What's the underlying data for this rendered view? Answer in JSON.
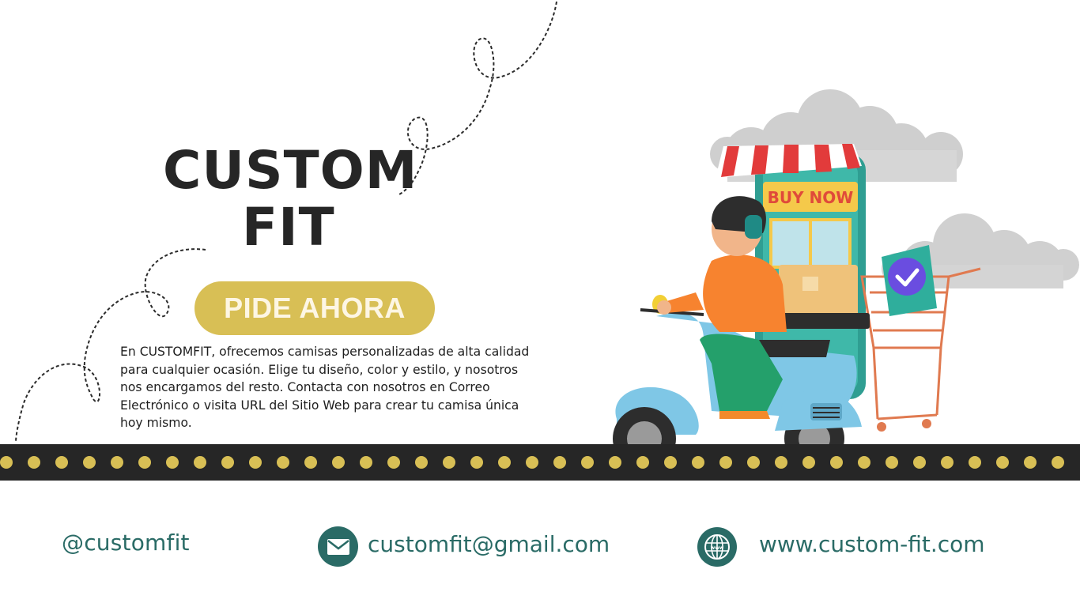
{
  "hero": {
    "title_line1": "CUSTOM",
    "title_line2": "FIT",
    "cta_label": "PIDE AHORA",
    "description": "En CUSTOMFIT, ofrecemos camisas personalizadas de alta calidad para cualquier ocasión. Elige tu diseño, color y estilo, y nosotros nos encargamos del resto. Contacta con nosotros en Correo Electrónico o visita URL del Sitio Web para crear tu camisa única hoy mismo."
  },
  "illustration": {
    "sign_text": "BUY NOW"
  },
  "footer": {
    "handle": "@customfit",
    "email": "customfit@gmail.com",
    "website": "www.custom-fit.com"
  },
  "icons": {
    "email": "envelope-icon",
    "website": "globe-icon"
  },
  "colors": {
    "accent_gold": "#d8bf55",
    "teal": "#2a6b66",
    "dark": "#262626"
  }
}
